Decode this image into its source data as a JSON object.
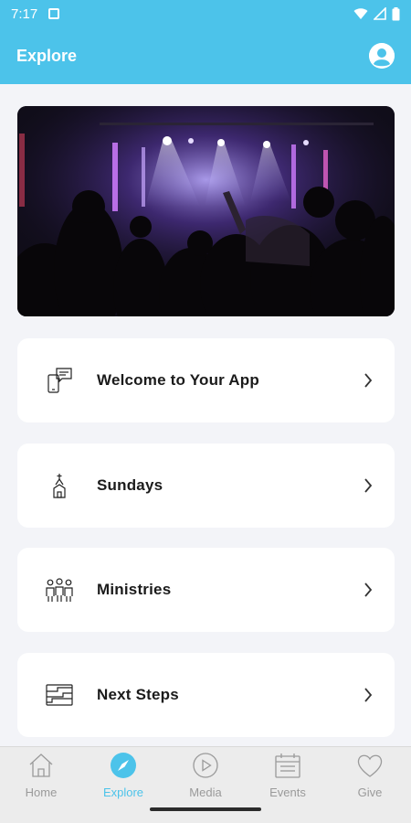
{
  "status_bar": {
    "time": "7:17",
    "icons": [
      "notification-icon",
      "wifi-icon",
      "signal-icon",
      "battery-icon"
    ]
  },
  "header": {
    "title": "Explore",
    "profile_icon": "profile-icon",
    "background_color": "#4cc3ea"
  },
  "hero": {
    "icon": "worship-concert-photo"
  },
  "cards": [
    {
      "label": "Welcome to Your App",
      "icon": "welcome-phone-icon"
    },
    {
      "label": "Sundays",
      "icon": "church-icon"
    },
    {
      "label": "Ministries",
      "icon": "people-icon"
    },
    {
      "label": "Next Steps",
      "icon": "steps-icon"
    }
  ],
  "bottom_nav": {
    "active": "Explore",
    "accent_color": "#4cc3ea",
    "items": [
      {
        "label": "Home",
        "icon": "home-icon"
      },
      {
        "label": "Explore",
        "icon": "compass-icon"
      },
      {
        "label": "Media",
        "icon": "play-icon"
      },
      {
        "label": "Events",
        "icon": "calendar-icon"
      },
      {
        "label": "Give",
        "icon": "heart-icon"
      }
    ]
  }
}
